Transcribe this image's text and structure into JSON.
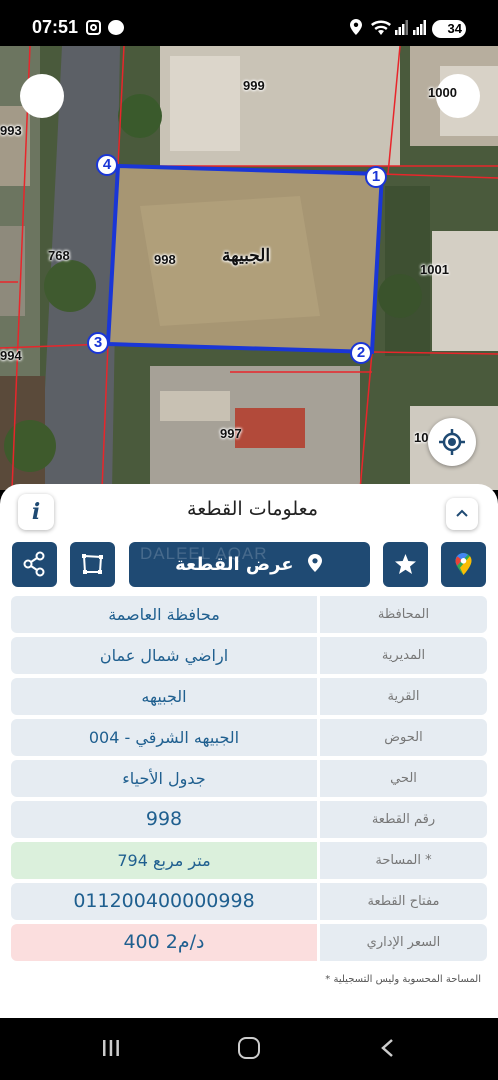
{
  "status_bar": {
    "time": "07:51",
    "battery": "34"
  },
  "map": {
    "parcel_labels": {
      "p999": "999",
      "p1000": "1000",
      "p993": "993",
      "p768": "768",
      "p998": "998",
      "p1001": "1001",
      "p994": "994",
      "p997": "997",
      "p10": "10"
    },
    "village_name": "الجبيهة",
    "vertices": [
      "1",
      "2",
      "3",
      "4"
    ],
    "boundary_color": "#1a36d6",
    "parcel_line_color": "#e8262b"
  },
  "panel": {
    "title": "معلومات القطعة",
    "info_label": "i",
    "show_plot_label": "عرض القطعة",
    "watermark": "DALEEL AQAR",
    "rows": [
      {
        "label": "المحافظة",
        "value": "محافظة العاصمة"
      },
      {
        "label": "المديرية",
        "value": "اراضي شمال عمان"
      },
      {
        "label": "القرية",
        "value": "الجبيهه"
      },
      {
        "label": "الحوض",
        "value": "الجبيهه الشرقي - 004"
      },
      {
        "label": "الحي",
        "value": "جدول الأحياء"
      },
      {
        "label": "رقم القطعة",
        "value": "998"
      },
      {
        "label": "المساحة *",
        "value": "794  متر مربع"
      },
      {
        "label": "مفتاح القطعة",
        "value": "011200400000998"
      },
      {
        "label": "السعر الإداري",
        "value": "400 د/م2"
      }
    ],
    "footnote": "* المساحة المحسوبة وليس التسجيلية"
  },
  "colors": {
    "accent": "#1f4a73",
    "row_bg": "#e6ecf2",
    "area_bg": "#dbf0dc",
    "price_bg": "#fbdede"
  }
}
